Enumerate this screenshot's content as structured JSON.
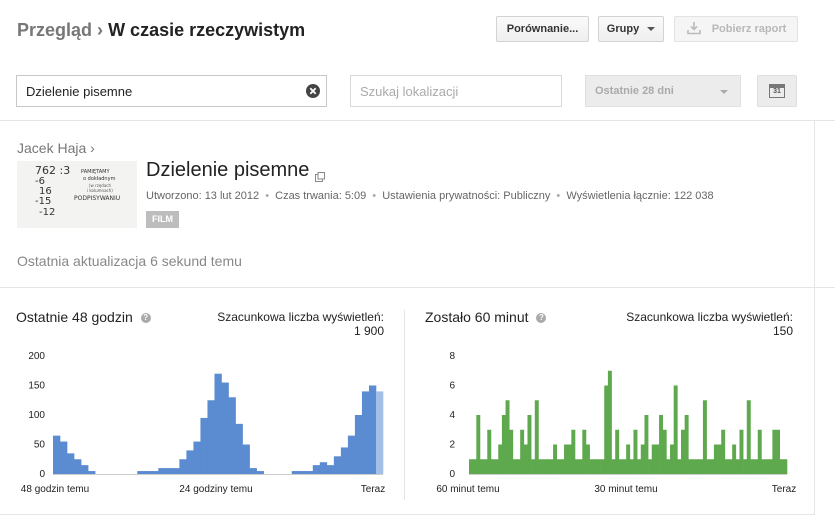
{
  "header": {
    "breadcrumb_root": "Przegląd",
    "breadcrumb_sep": "›",
    "page_title": "W czasie rzeczywistym",
    "compare_label": "Porównanie...",
    "groups_label": "Grupy",
    "download_label": "Pobierz raport"
  },
  "filters": {
    "search_value": "Dzielenie pisemne",
    "location_placeholder": "Szukaj lokalizacji",
    "date_range": "Ostatnie 28 dni",
    "calendar_day": "31"
  },
  "video": {
    "channel": "Jacek Haja",
    "channel_chevron": "›",
    "title": "Dzielenie pisemne",
    "created": "Utworzono: 13 lut 2012",
    "duration": "Czas trwania: 5:09",
    "privacy": "Ustawienia prywatności: Publiczny",
    "total_views": "Wyświetlenia łącznie: 122 038",
    "badge": "FILM",
    "dot": "•",
    "thumb": {
      "line1": "762 :3",
      "line2": "-6",
      "line3": "16",
      "line4": "-15",
      "line5": "-12",
      "note1": "PAMIĘTAMY",
      "note2": "o dokładnym",
      "note3": "(w rzędach",
      "note4": "i kolumnach)",
      "note5": "PODPISYWANIU"
    }
  },
  "last_update": "Ostatnia aktualizacja 6 sekund temu",
  "panels": {
    "left": {
      "title": "Ostatnie 48 godzin",
      "help": "?",
      "est_label": "Szacunkowa liczba wyświetleń:",
      "est_value": "1 900"
    },
    "right": {
      "title": "Zostało 60 minut",
      "help": "?",
      "est_label": "Szacunkowa liczba wyświetleń:",
      "est_value": "150"
    }
  },
  "chart_data": [
    {
      "type": "bar",
      "title": "Ostatnie 48 godzin",
      "xlabel": "",
      "ylabel": "",
      "x_labels": [
        "48 godzin temu",
        "24 godziny temu",
        "Teraz"
      ],
      "yticks": [
        0,
        50,
        100,
        150,
        200
      ],
      "ylim": [
        0,
        200
      ],
      "color": "#5b8bd0",
      "last_bar_color": "#a4bfe6",
      "grid": false,
      "values": [
        65,
        55,
        35,
        25,
        15,
        5,
        0,
        0,
        0,
        0,
        0,
        0,
        5,
        5,
        5,
        10,
        10,
        10,
        25,
        40,
        55,
        95,
        125,
        170,
        155,
        130,
        85,
        50,
        10,
        5,
        0,
        0,
        0,
        0,
        5,
        5,
        5,
        15,
        20,
        15,
        30,
        45,
        65,
        100,
        140,
        150,
        140
      ]
    },
    {
      "type": "bar",
      "title": "Zostało 60 minut",
      "xlabel": "",
      "ylabel": "",
      "x_labels": [
        "60 minut temu",
        "30 minut temu",
        "Teraz"
      ],
      "yticks": [
        0,
        2,
        4,
        6,
        8
      ],
      "ylim": [
        0,
        8
      ],
      "color": "#5ea84e",
      "grid": false,
      "values": [
        1,
        1,
        4,
        1,
        1,
        3,
        1,
        1,
        2,
        4,
        5,
        3,
        1,
        1,
        3,
        2,
        4,
        1,
        5,
        1,
        1,
        1,
        1,
        2,
        1,
        1,
        2,
        2,
        3,
        1,
        1,
        3,
        2,
        1,
        1,
        1,
        1,
        6,
        7,
        1,
        3,
        1,
        1,
        2,
        1,
        3,
        1,
        2,
        4,
        1,
        2,
        2,
        4,
        3,
        1,
        2,
        6,
        1,
        3,
        4,
        1,
        1,
        1,
        1,
        5,
        1,
        1,
        2,
        2,
        3,
        1,
        1,
        2,
        1,
        3,
        1,
        5,
        1,
        1,
        3,
        1,
        1,
        1,
        3,
        3,
        1,
        1
      ]
    }
  ]
}
